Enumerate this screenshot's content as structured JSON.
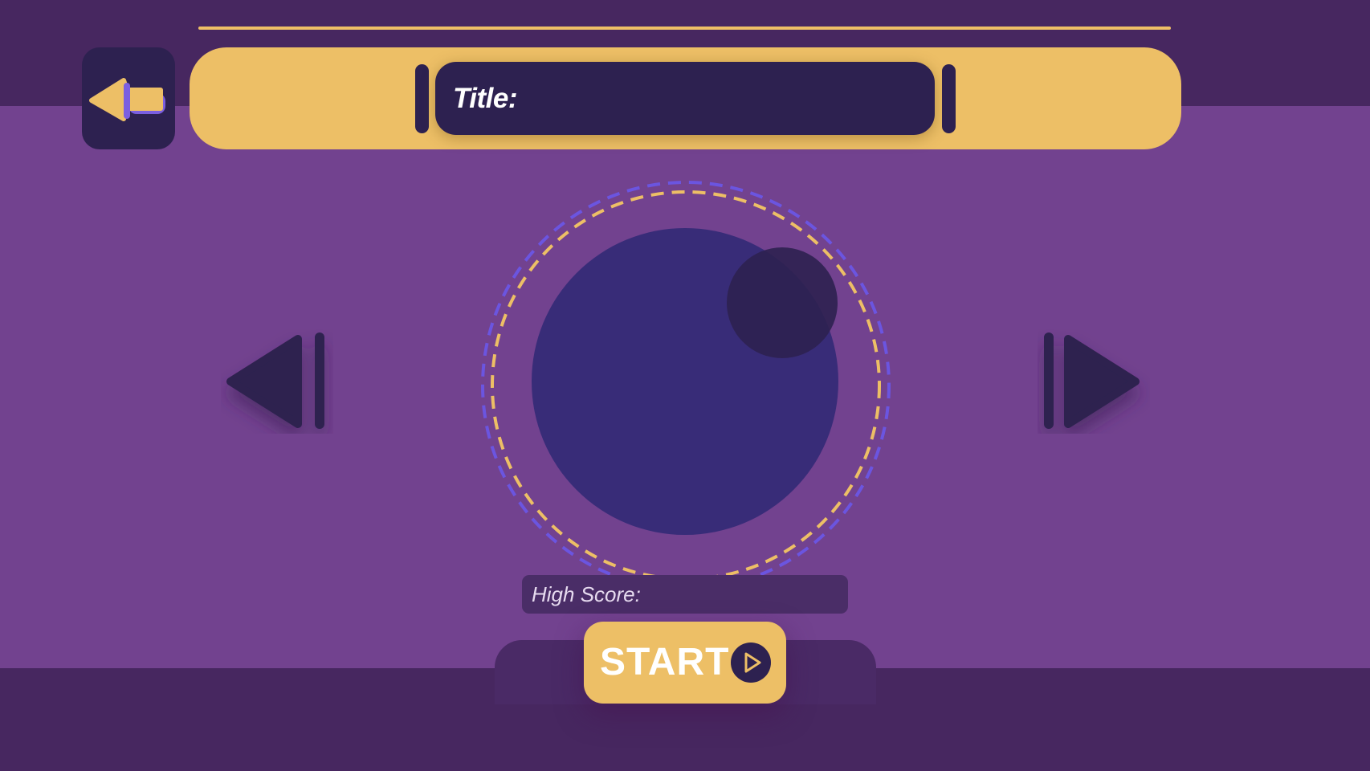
{
  "colors": {
    "background": "#72428f",
    "band": "#472760",
    "accent": "#edbf66",
    "dark": "#2d2150",
    "orb": "#382c78",
    "ring_outer": "#6b55e0"
  },
  "header": {
    "back_icon": "arrow-left-icon",
    "title_label": "Title:"
  },
  "carousel": {
    "prev_icon": "skip-previous-icon",
    "next_icon": "skip-next-icon"
  },
  "score": {
    "label": "High Score:"
  },
  "start": {
    "label": "START",
    "icon": "play-icon"
  }
}
